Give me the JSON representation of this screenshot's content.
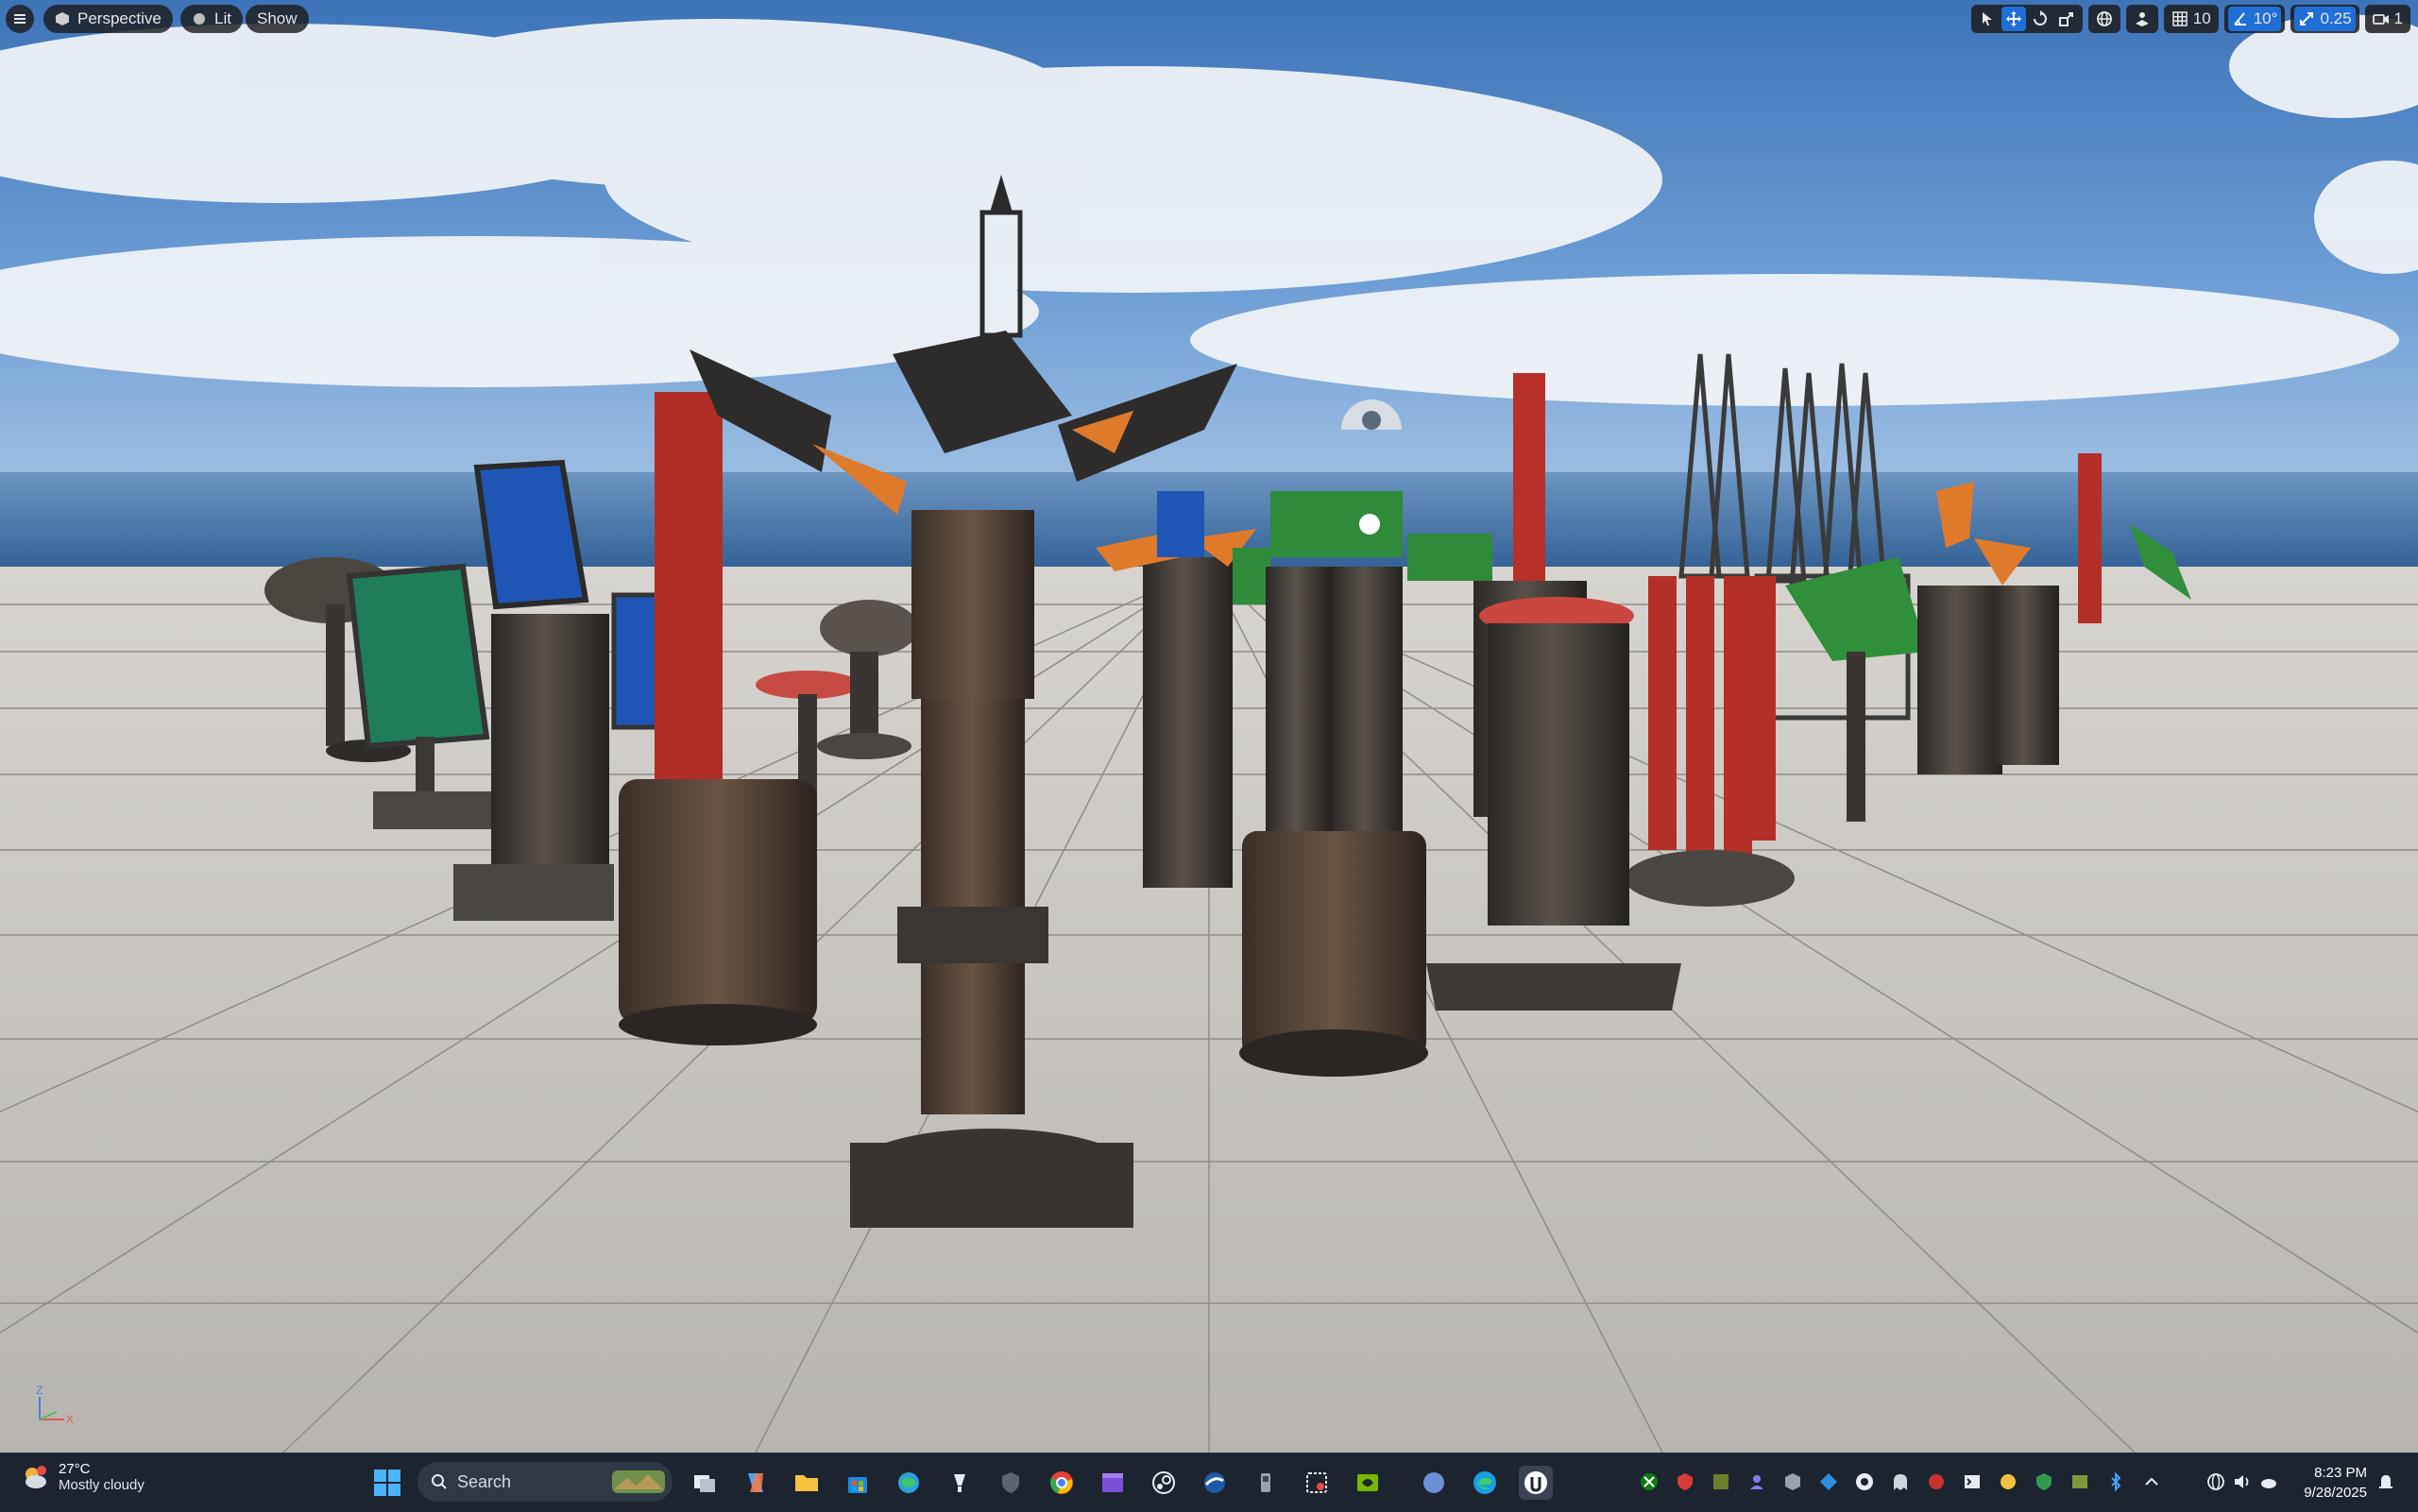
{
  "viewport": {
    "menu_icon": "hamburger-menu-icon",
    "view_mode_label": "Perspective",
    "lighting_mode_label": "Lit",
    "show_label": "Show",
    "grid_snap_value": "10",
    "rotation_snap_value": "10°",
    "scale_snap_value": "0.25",
    "camera_speed_value": "1",
    "axis_label_z": "Z",
    "axis_label_x": "X",
    "colors": {
      "accent": "#1f6fd6",
      "sky_top": "#3d74b8",
      "floor": "#c9c6c2"
    }
  },
  "taskbar": {
    "weather_temp": "27°C",
    "weather_desc": "Mostly cloudy",
    "search_placeholder": "Search",
    "time": "8:23 PM",
    "date": "9/28/2025",
    "pinned_apps": [
      "windows-start",
      "task-view",
      "copilot",
      "file-explorer",
      "microsoft-store",
      "browser",
      "app",
      "app",
      "chrome",
      "app",
      "steam",
      "app",
      "app",
      "app",
      "nvidia",
      "app",
      "edge",
      "unreal-engine"
    ],
    "tray_icons": [
      "xbox",
      "app",
      "app",
      "app",
      "app",
      "app",
      "app",
      "app",
      "app",
      "app",
      "app",
      "app",
      "app",
      "app",
      "app",
      "network",
      "volume",
      "battery"
    ]
  }
}
